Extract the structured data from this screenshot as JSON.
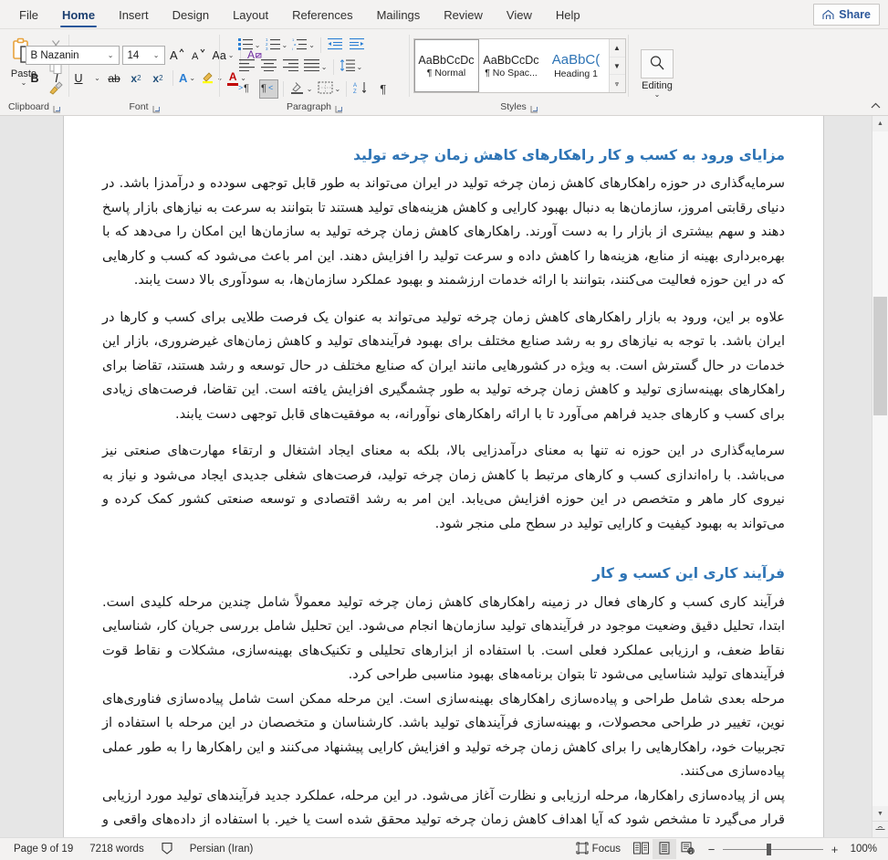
{
  "window": {
    "tabs": [
      {
        "label": "File",
        "active": false
      },
      {
        "label": "Home",
        "active": true
      },
      {
        "label": "Insert",
        "active": false
      },
      {
        "label": "Design",
        "active": false
      },
      {
        "label": "Layout",
        "active": false
      },
      {
        "label": "References",
        "active": false
      },
      {
        "label": "Mailings",
        "active": false
      },
      {
        "label": "Review",
        "active": false
      },
      {
        "label": "View",
        "active": false
      },
      {
        "label": "Help",
        "active": false
      }
    ],
    "share_label": "Share",
    "share_icon": "share-icon",
    "collapse_ribbon_icon": "chevron-up-icon"
  },
  "ribbon": {
    "clipboard": {
      "group_label": "Clipboard",
      "paste_label": "Paste",
      "paste_icon": "paste-icon",
      "paste_chevron": "⌄",
      "cut_icon": "scissors-icon",
      "copy_icon": "copy-icon",
      "format_painter_icon": "format-painter-icon",
      "launcher_icon": "dialog-launcher-icon"
    },
    "font": {
      "group_label": "Font",
      "font_name": "B Nazanin",
      "font_size": "14",
      "grow_font_icon": "grow-font-icon",
      "shrink_font_icon": "shrink-font-icon",
      "change_case_label": "Aa",
      "clear_formatting_icon": "clear-formatting-icon",
      "bold_label": "B",
      "italic_label": "I",
      "underline_label": "U",
      "strikethrough_label": "ab",
      "subscript_label": "x",
      "subscript_sup": "2",
      "superscript_label": "x",
      "superscript_sup": "2",
      "text_effects_label": "A",
      "highlight_icon": "highlight-icon",
      "font_color_label": "A",
      "launcher_icon": "dialog-launcher-icon",
      "chevron": "⌄"
    },
    "paragraph": {
      "group_label": "Paragraph",
      "bullets_icon": "bullets-icon",
      "numbering_icon": "numbering-icon",
      "multilevel_icon": "multilevel-list-icon",
      "decrease_indent_icon": "decrease-indent-icon",
      "increase_indent_icon": "increase-indent-icon",
      "align_left_icon": "align-left-icon",
      "align_center_icon": "align-center-icon",
      "align_right_icon": "align-right-icon",
      "justify_icon": "justify-icon",
      "line_spacing_icon": "line-spacing-icon",
      "ltr_icon": "left-to-right-icon",
      "rtl_icon": "right-to-left-icon",
      "shading_icon": "shading-icon",
      "borders_icon": "borders-icon",
      "sort_icon": "sort-icon",
      "show_marks_label": "¶",
      "launcher_icon": "dialog-launcher-icon",
      "chevron": "⌄"
    },
    "styles": {
      "group_label": "Styles",
      "cards": [
        {
          "preview": "AaBbCcDc",
          "name": "¶ Normal",
          "selected": true
        },
        {
          "preview": "AaBbCcDc",
          "name": "¶ No Spac...",
          "selected": false
        },
        {
          "preview": "AaBbC(",
          "name": "Heading 1",
          "selected": false
        }
      ],
      "scroll_up_icon": "chevron-up-icon",
      "scroll_down_icon": "chevron-down-icon",
      "more_icon": "styles-more-icon",
      "launcher_icon": "dialog-launcher-icon"
    },
    "editing": {
      "group_label": "Editing",
      "icon": "search-icon",
      "chevron": "⌄"
    }
  },
  "document": {
    "blocks": [
      {
        "type": "heading",
        "text": "مزایای ورود به کسب و کار راهکارهای کاهش زمان چرخه تولید"
      },
      {
        "type": "paragraph",
        "text": "سرمایه‌گذاری در حوزه راهکارهای کاهش زمان چرخه تولید در ایران می‌تواند به طور قابل توجهی سودده و درآمدزا باشد. در دنیای رقابتی امروز، سازمان‌ها به دنبال بهبود کارایی و کاهش هزینه‌های تولید هستند تا بتوانند به سرعت به نیازهای بازار پاسخ دهند و سهم بیشتری از بازار را به دست آورند. راهکارهای کاهش زمان چرخه تولید به سازمان‌ها این امکان را می‌دهد که با بهره‌برداری بهینه از منابع، هزینه‌ها را کاهش داده و سرعت تولید را افزایش دهند. این امر باعث می‌شود که کسب و کارهایی که در این حوزه فعالیت می‌کنند، بتوانند با ارائه خدمات ارزشمند و بهبود عملکرد سازمان‌ها، به سودآوری بالا دست یابند."
      },
      {
        "type": "paragraph",
        "text": "علاوه بر این، ورود به بازار راهکارهای کاهش زمان چرخه تولید می‌تواند به عنوان یک فرصت طلایی برای کسب و کارها در ایران باشد. با توجه به نیازهای رو به رشد صنایع مختلف برای بهبود فرآیندهای تولید و کاهش زمان‌های غیرضروری، بازار این خدمات در حال گسترش است. به ویژه در کشورهایی مانند ایران که صنایع مختلف در حال توسعه و رشد هستند، تقاضا برای راهکارهای بهینه‌سازی تولید و کاهش زمان چرخه تولید به طور چشمگیری افزایش یافته است. این تقاضا، فرصت‌های زیادی برای کسب و کارهای جدید فراهم می‌آورد تا با ارائه راهکارهای نوآورانه، به موفقیت‌های قابل توجهی دست یابند."
      },
      {
        "type": "paragraph",
        "text": "سرمایه‌گذاری در این حوزه نه تنها به معنای درآمدزایی بالا، بلکه به معنای ایجاد اشتغال و ارتقاء مهارت‌های صنعتی نیز می‌باشد. با راه‌اندازی کسب و کارهای مرتبط با کاهش زمان چرخه تولید، فرصت‌های شغلی جدیدی ایجاد می‌شود و نیاز به نیروی کار ماهر و متخصص در این حوزه افزایش می‌یابد. این امر به رشد اقتصادی و توسعه صنعتی کشور کمک کرده و می‌تواند به بهبود کیفیت و کارایی تولید در سطح ملی منجر شود."
      },
      {
        "type": "heading",
        "text": "فرآیند کاری این کسب و کار"
      },
      {
        "type": "paragraph",
        "text": "فرآیند کاری کسب و کارهای فعال در زمینه راهکارهای کاهش زمان چرخه تولید معمولاً شامل چندین مرحله کلیدی است. ابتدا، تحلیل دقیق وضعیت موجود در فرآیندهای تولید سازمان‌ها انجام می‌شود. این تحلیل شامل بررسی جریان کار، شناسایی نقاط ضعف، و ارزیابی عملکرد فعلی است. با استفاده از ابزارهای تحلیلی و تکنیک‌های بهینه‌سازی، مشکلات و نقاط قوت فرآیندهای تولید شناسایی می‌شود تا بتوان برنامه‌های بهبود مناسبی طراحی کرد."
      },
      {
        "type": "paragraph",
        "text": "مرحله بعدی شامل طراحی و پیاده‌سازی راهکارهای بهینه‌سازی است. این مرحله ممکن است شامل پیاده‌سازی فناوری‌های نوین، تغییر در طراحی محصولات، و بهینه‌سازی فرآیندهای تولید باشد. کارشناسان و متخصصان در این مرحله با استفاده از تجربیات خود، راهکارهایی را برای کاهش زمان چرخه تولید و افزایش کارایی پیشنهاد می‌کنند و این راهکارها را به طور عملی پیاده‌سازی می‌کنند."
      },
      {
        "type": "paragraph",
        "text": "پس از پیاده‌سازی راهکارها، مرحله ارزیابی و نظارت آغاز می‌شود. در این مرحله، عملکرد جدید فرآیندهای تولید مورد ارزیابی قرار می‌گیرد تا مشخص شود که آیا اهداف کاهش زمان چرخه تولید محقق شده است یا خیر. با استفاده از داده‌های واقعی و تحلیل‌های دقیق، میزان موفقیت راهکارها"
      }
    ]
  },
  "status_bar": {
    "page_label": "Page 9 of 19",
    "word_count": "7218 words",
    "proofing_icon": "proofing-icon",
    "language": "Persian (Iran)",
    "focus_label": "Focus",
    "focus_icon": "focus-icon",
    "read_mode_icon": "read-mode-icon",
    "print_layout_icon": "print-layout-icon",
    "web_layout_icon": "web-layout-icon",
    "zoom_out_label": "−",
    "zoom_in_label": "+",
    "zoom_level": "100%"
  },
  "colors": {
    "accent": "#2b579a",
    "heading": "#2e74b5",
    "ribbon_bg": "#f3f2f1",
    "doc_bg": "#e6e6e6"
  }
}
